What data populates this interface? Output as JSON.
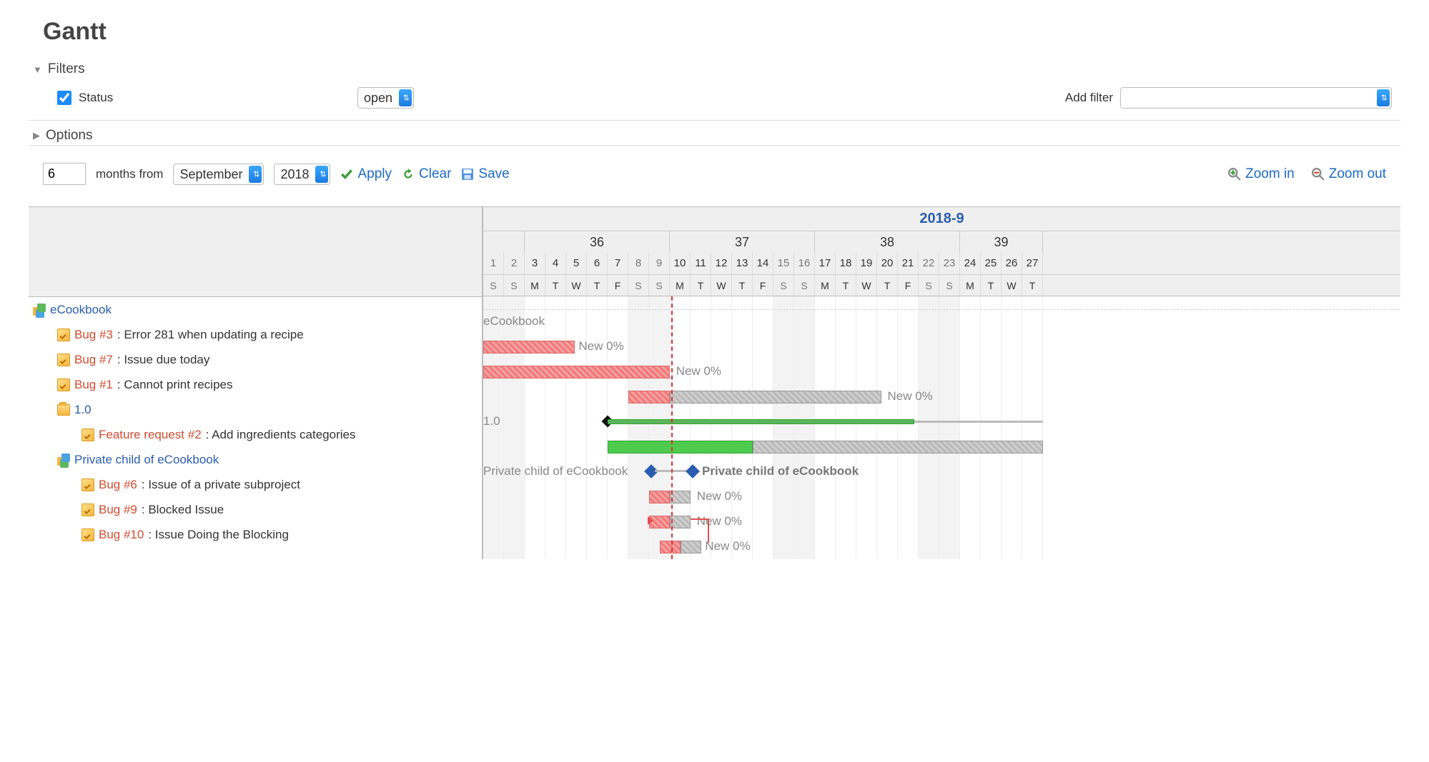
{
  "title": "Gantt",
  "filters": {
    "legend": "Filters",
    "status_label": "Status",
    "status_checked": true,
    "status_value": "open",
    "add_filter_label": "Add filter"
  },
  "options": {
    "legend": "Options"
  },
  "controls": {
    "months_value": "6",
    "months_from_label": "months from",
    "month_select": "September",
    "year_select": "2018",
    "apply": "Apply",
    "clear": "Clear",
    "save": "Save",
    "zoom_in": "Zoom in",
    "zoom_out": "Zoom out"
  },
  "timeline": {
    "month_header": "2018-9",
    "weeks": [
      {
        "num": "36",
        "span": 7
      },
      {
        "num": "37",
        "span": 7
      },
      {
        "num": "38",
        "span": 7
      },
      {
        "num": "39",
        "span": 4
      }
    ],
    "days": [
      "1",
      "2",
      "3",
      "4",
      "5",
      "6",
      "7",
      "8",
      "9",
      "10",
      "11",
      "12",
      "13",
      "14",
      "15",
      "16",
      "17",
      "18",
      "19",
      "20",
      "21",
      "22",
      "23",
      "24",
      "25",
      "26",
      "27"
    ],
    "wdays": [
      "S",
      "S",
      "M",
      "T",
      "W",
      "T",
      "F",
      "S",
      "S",
      "M",
      "T",
      "W",
      "T",
      "F",
      "S",
      "S",
      "M",
      "T",
      "W",
      "T",
      "F",
      "S",
      "S",
      "M",
      "T",
      "W",
      "T"
    ],
    "weekend_idx": [
      0,
      1,
      7,
      8,
      14,
      15,
      21,
      22
    ],
    "today_idx": 9
  },
  "rows": [
    {
      "type": "project",
      "indent": 0,
      "label": "eCookbook"
    },
    {
      "type": "issue",
      "indent": 1,
      "id": "Bug #3",
      "title": ": Error 281 when updating a recipe",
      "bars": [
        {
          "kind": "red",
          "start": 0,
          "span": 4.4
        }
      ],
      "label": "New 0%",
      "label_at": 4.6
    },
    {
      "type": "issue",
      "indent": 1,
      "id": "Bug #7",
      "title": ": Issue due today",
      "bars": [
        {
          "kind": "red",
          "start": 0,
          "span": 9
        }
      ],
      "label": "New 0%",
      "label_at": 9.3
    },
    {
      "type": "issue",
      "indent": 1,
      "id": "Bug #1",
      "title": ": Cannot print recipes",
      "bars": [
        {
          "kind": "red",
          "start": 7,
          "span": 2
        },
        {
          "kind": "grey",
          "start": 9,
          "span": 10.2
        }
      ],
      "label": "New 0%",
      "label_at": 19.5
    },
    {
      "type": "version",
      "indent": 1,
      "label": "1.0",
      "parent": {
        "start": 6,
        "end": 20.8,
        "thin_end": 27
      }
    },
    {
      "type": "issue",
      "indent": 2,
      "id": "Feature request #2",
      "title": ": Add ingredients categories",
      "bars": [
        {
          "kind": "green",
          "start": 6,
          "span": 7
        },
        {
          "kind": "grey",
          "start": 13,
          "span": 14
        }
      ]
    },
    {
      "type": "project",
      "indent": 1,
      "label": "Private child of eCookbook",
      "private": true,
      "diamonds": {
        "start": 8,
        "end": 10,
        "label": "Private child of eCookbook"
      }
    },
    {
      "type": "issue",
      "indent": 2,
      "id": "Bug #6",
      "title": ": Issue of a private subproject",
      "bars": [
        {
          "kind": "red",
          "start": 8,
          "span": 1
        },
        {
          "kind": "grey",
          "start": 9,
          "span": 1
        }
      ],
      "label": "New 0%",
      "label_at": 10.3
    },
    {
      "type": "issue",
      "indent": 2,
      "id": "Bug #9",
      "title": ": Blocked Issue",
      "bars": [
        {
          "kind": "red",
          "start": 8,
          "span": 1
        },
        {
          "kind": "grey",
          "start": 9,
          "span": 1
        }
      ],
      "label": "New 0%",
      "label_at": 10.3,
      "arrow_left": true
    },
    {
      "type": "issue",
      "indent": 2,
      "id": "Bug #10",
      "title": ": Issue Doing the Blocking",
      "bars": [
        {
          "kind": "red",
          "start": 8.5,
          "span": 1
        },
        {
          "kind": "grey",
          "start": 9.5,
          "span": 1
        }
      ],
      "label": "New 0%",
      "label_at": 10.7,
      "arrow_down": true
    }
  ]
}
